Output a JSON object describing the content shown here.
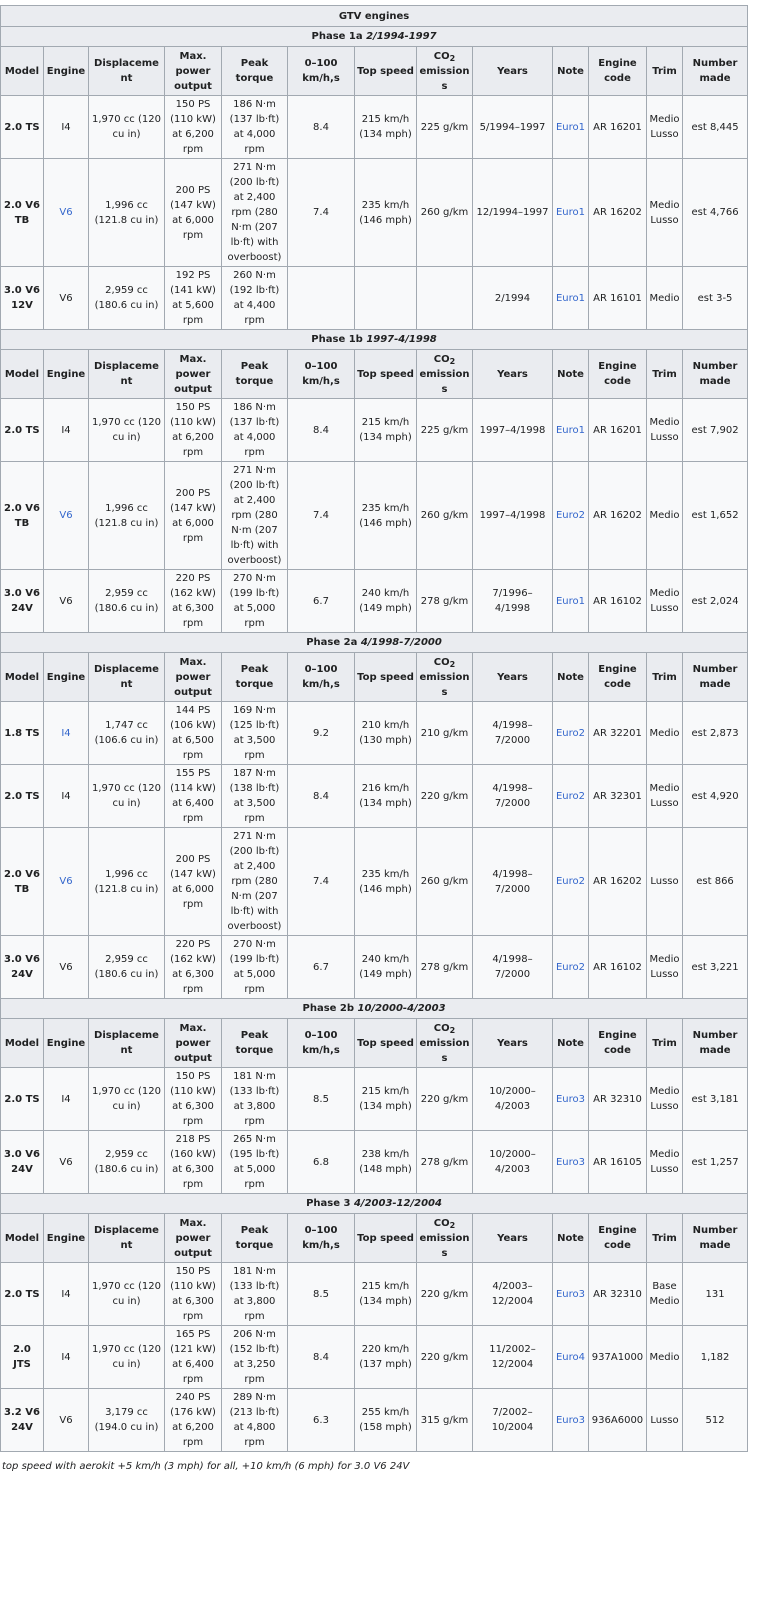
{
  "caption": "GTV engines",
  "headers": {
    "model": "Model",
    "engine": "Engine",
    "displacement": "Displacement",
    "power": "Max. power output",
    "torque": "Peak torque",
    "accel": "0–100 km/h,s",
    "top_speed": "Top speed",
    "co2_main": "CO",
    "co2_sub": "2",
    "co2_tail": "emissions",
    "years": "Years",
    "note": "Note",
    "engine_code": "Engine code",
    "trim": "Trim",
    "number_made": "Number made"
  },
  "phases": [
    {
      "name": "Phase 1a",
      "period": "2/1994-1997",
      "rows": [
        {
          "model": "2.0 TS",
          "engine": "I4",
          "engine_link": false,
          "displacement": "1,970 cc (120 cu in)",
          "power": "150 PS (110 kW) at 6,200 rpm",
          "torque": "186 N·m (137 lb·ft) at 4,000 rpm",
          "accel": "8.4",
          "top": "215 km/h (134 mph)",
          "co2": "225 g/km",
          "years": "5/1994–1997",
          "note": "Euro1",
          "code": "AR 16201",
          "trim": "Medio Lusso",
          "made": "est 8,445"
        },
        {
          "model": "2.0 V6 TB",
          "engine": "V6",
          "engine_link": true,
          "displacement": "1,996 cc (121.8 cu in)",
          "power": "200 PS (147 kW) at 6,000 rpm",
          "torque": "271 N·m (200 lb·ft) at 2,400 rpm (280 N·m (207 lb·ft) with overboost)",
          "accel": "7.4",
          "top": "235 km/h (146 mph)",
          "co2": "260 g/km",
          "years": "12/1994–1997",
          "note": "Euro1",
          "code": "AR 16202",
          "trim": "Medio Lusso",
          "made": "est 4,766"
        },
        {
          "model": "3.0 V6 12V",
          "engine": "V6",
          "engine_link": false,
          "displacement": "2,959 cc (180.6 cu in)",
          "power": "192 PS (141 kW) at 5,600 rpm",
          "torque": "260 N·m (192 lb·ft) at 4,400 rpm",
          "accel": "",
          "top": "",
          "co2": "",
          "years": "2/1994",
          "note": "Euro1",
          "code": "AR 16101",
          "trim": "Medio",
          "made": "est 3-5"
        }
      ]
    },
    {
      "name": "Phase 1b",
      "period": "1997-4/1998",
      "rows": [
        {
          "model": "2.0 TS",
          "engine": "I4",
          "engine_link": false,
          "displacement": "1,970 cc (120 cu in)",
          "power": "150 PS (110 kW) at 6,200 rpm",
          "torque": "186 N·m (137 lb·ft) at 4,000 rpm",
          "accel": "8.4",
          "top": "215 km/h (134 mph)",
          "co2": "225 g/km",
          "years": "1997–4/1998",
          "note": "Euro1",
          "code": "AR 16201",
          "trim": "Medio Lusso",
          "made": "est 7,902"
        },
        {
          "model": "2.0 V6 TB",
          "engine": "V6",
          "engine_link": true,
          "displacement": "1,996 cc (121.8 cu in)",
          "power": "200 PS (147 kW) at 6,000 rpm",
          "torque": "271 N·m (200 lb·ft) at 2,400 rpm (280 N·m (207 lb·ft) with overboost)",
          "accel": "7.4",
          "top": "235 km/h (146 mph)",
          "co2": "260 g/km",
          "years": "1997–4/1998",
          "note": "Euro2",
          "code": "AR 16202",
          "trim": "Medio",
          "made": "est 1,652"
        },
        {
          "model": "3.0 V6 24V",
          "engine": "V6",
          "engine_link": false,
          "displacement": "2,959 cc (180.6 cu in)",
          "power": "220 PS (162 kW) at 6,300 rpm",
          "torque": "270 N·m (199 lb·ft) at 5,000 rpm",
          "accel": "6.7",
          "top": "240 km/h (149 mph)",
          "co2": "278 g/km",
          "years": "7/1996–4/1998",
          "note": "Euro1",
          "code": "AR 16102",
          "trim": "Medio Lusso",
          "made": "est 2,024"
        }
      ]
    },
    {
      "name": "Phase 2a",
      "period": "4/1998-7/2000",
      "rows": [
        {
          "model": "1.8 TS",
          "engine": "I4",
          "engine_link": true,
          "displacement": "1,747 cc (106.6 cu in)",
          "power": "144 PS (106 kW) at 6,500 rpm",
          "torque": "169 N·m (125 lb·ft) at 3,500 rpm",
          "accel": "9.2",
          "top": "210 km/h (130 mph)",
          "co2": "210 g/km",
          "years": "4/1998–7/2000",
          "note": "Euro2",
          "code": "AR 32201",
          "trim": "Medio",
          "made": "est 2,873"
        },
        {
          "model": "2.0 TS",
          "engine": "I4",
          "engine_link": false,
          "displacement": "1,970 cc (120 cu in)",
          "power": "155 PS (114 kW) at 6,400 rpm",
          "torque": "187 N·m (138 lb·ft) at 3,500 rpm",
          "accel": "8.4",
          "top": "216 km/h (134 mph)",
          "co2": "220 g/km",
          "years": "4/1998–7/2000",
          "note": "Euro2",
          "code": "AR 32301",
          "trim": "Medio Lusso",
          "made": "est 4,920"
        },
        {
          "model": "2.0 V6 TB",
          "engine": "V6",
          "engine_link": true,
          "displacement": "1,996 cc (121.8 cu in)",
          "power": "200 PS (147 kW) at 6,000 rpm",
          "torque": "271 N·m (200 lb·ft) at 2,400 rpm (280 N·m (207 lb·ft) with overboost)",
          "accel": "7.4",
          "top": "235 km/h (146 mph)",
          "co2": "260 g/km",
          "years": "4/1998–7/2000",
          "note": "Euro2",
          "code": "AR 16202",
          "trim": "Lusso",
          "made": "est 866"
        },
        {
          "model": "3.0 V6 24V",
          "engine": "V6",
          "engine_link": false,
          "displacement": "2,959 cc (180.6 cu in)",
          "power": "220 PS (162 kW) at 6,300 rpm",
          "torque": "270 N·m (199 lb·ft) at 5,000 rpm",
          "accel": "6.7",
          "top": "240 km/h (149 mph)",
          "co2": "278 g/km",
          "years": "4/1998–7/2000",
          "note": "Euro2",
          "code": "AR 16102",
          "trim": "Medio Lusso",
          "made": "est 3,221"
        }
      ]
    },
    {
      "name": "Phase 2b",
      "period": "10/2000-4/2003",
      "rows": [
        {
          "model": "2.0 TS",
          "engine": "I4",
          "engine_link": false,
          "displacement": "1,970 cc (120 cu in)",
          "power": "150 PS (110 kW) at 6,300 rpm",
          "torque": "181 N·m (133 lb·ft) at 3,800 rpm",
          "accel": "8.5",
          "top": "215 km/h (134 mph)",
          "co2": "220 g/km",
          "years": "10/2000–4/2003",
          "note": "Euro3",
          "code": "AR 32310",
          "trim": "Medio Lusso",
          "made": "est 3,181"
        },
        {
          "model": "3.0 V6 24V",
          "engine": "V6",
          "engine_link": false,
          "displacement": "2,959 cc (180.6 cu in)",
          "power": "218 PS (160 kW) at 6,300 rpm",
          "torque": "265 N·m (195 lb·ft) at 5,000 rpm",
          "accel": "6.8",
          "top": "238 km/h (148 mph)",
          "co2": "278 g/km",
          "years": "10/2000–4/2003",
          "note": "Euro3",
          "code": "AR 16105",
          "trim": "Medio Lusso",
          "made": "est 1,257"
        }
      ]
    },
    {
      "name": "Phase 3",
      "period": "4/2003-12/2004",
      "rows": [
        {
          "model": "2.0 TS",
          "engine": "I4",
          "engine_link": false,
          "displacement": "1,970 cc (120 cu in)",
          "power": "150 PS (110 kW) at 6,300 rpm",
          "torque": "181 N·m (133 lb·ft) at 3,800 rpm",
          "accel": "8.5",
          "top": "215 km/h (134 mph)",
          "co2": "220 g/km",
          "years": "4/2003–12/2004",
          "note": "Euro3",
          "code": "AR 32310",
          "trim": "Base Medio",
          "made": "131"
        },
        {
          "model": "2.0 JTS",
          "engine": "I4",
          "engine_link": false,
          "displacement": "1,970 cc (120 cu in)",
          "power": "165 PS (121 kW) at 6,400 rpm",
          "torque": "206 N·m (152 lb·ft) at 3,250 rpm",
          "accel": "8.4",
          "top": "220 km/h (137 mph)",
          "co2": "220 g/km",
          "years": "11/2002–12/2004",
          "note": "Euro4",
          "code": "937A1000",
          "trim": "Medio",
          "made": "1,182"
        },
        {
          "model": "3.2 V6 24V",
          "engine": "V6",
          "engine_link": false,
          "displacement": "3,179 cc (194.0 cu in)",
          "power": "240 PS (176 kW) at 6,200 rpm",
          "torque": "289 N·m (213 lb·ft) at 4,800 rpm",
          "accel": "6.3",
          "top": "255 km/h (158 mph)",
          "co2": "315 g/km",
          "years": "7/2002–10/2004",
          "note": "Euro3",
          "code": "936A6000",
          "trim": "Lusso",
          "made": "512"
        }
      ]
    }
  ],
  "footnote": "top speed with aerokit +5 km/h (3 mph) for all, +10 km/h (6 mph) for 3.0 V6 24V"
}
